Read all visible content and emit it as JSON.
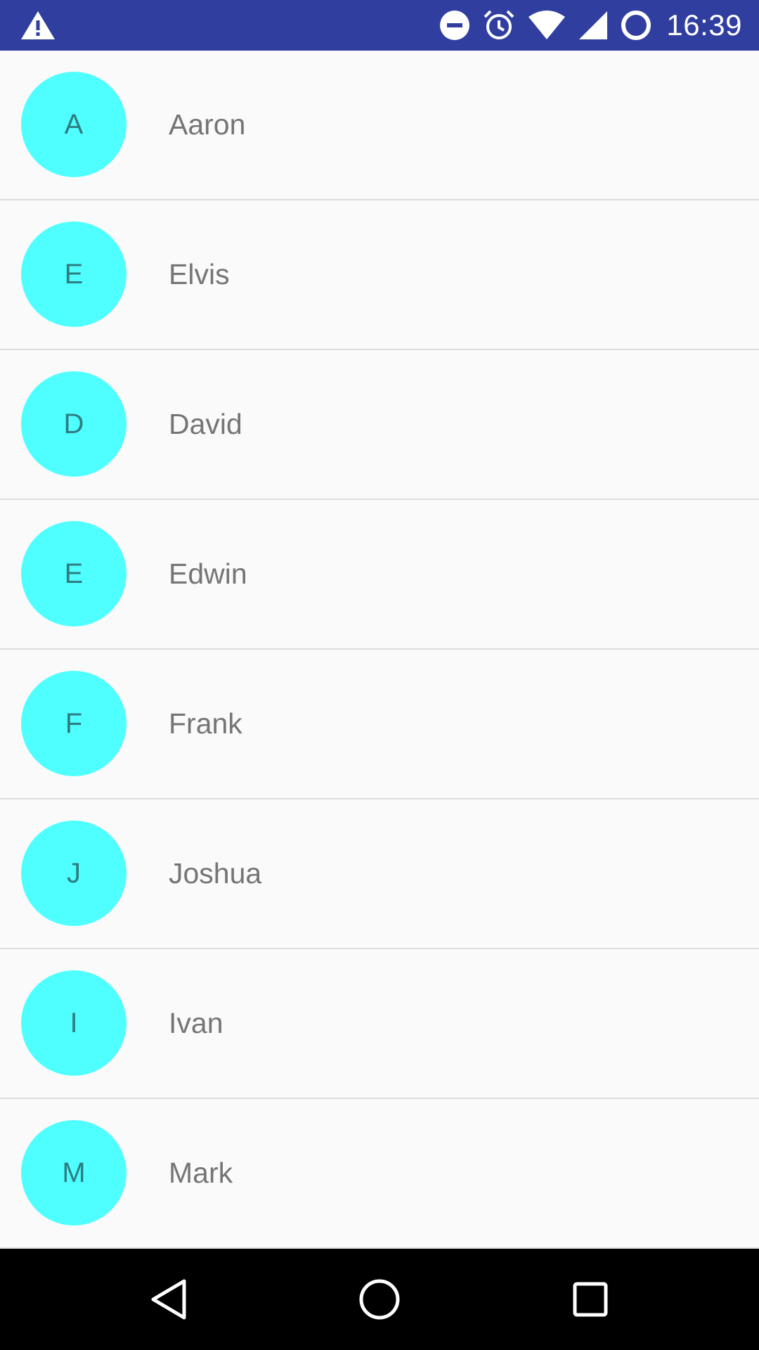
{
  "status_bar": {
    "time": "16:39",
    "icons": [
      "warning-icon",
      "do-not-disturb-icon",
      "alarm-icon",
      "wifi-icon",
      "signal-icon",
      "battery-icon"
    ],
    "background_color": "#303F9F"
  },
  "contacts": [
    {
      "initial": "A",
      "name": "Aaron"
    },
    {
      "initial": "E",
      "name": "Elvis"
    },
    {
      "initial": "D",
      "name": "David"
    },
    {
      "initial": "E",
      "name": "Edwin"
    },
    {
      "initial": "F",
      "name": "Frank"
    },
    {
      "initial": "J",
      "name": "Joshua"
    },
    {
      "initial": "I",
      "name": "Ivan"
    },
    {
      "initial": "M",
      "name": "Mark"
    }
  ],
  "avatar_color": "#4FFFFF",
  "nav_bar": {
    "icons": [
      "back-icon",
      "home-icon",
      "recents-icon"
    ]
  }
}
